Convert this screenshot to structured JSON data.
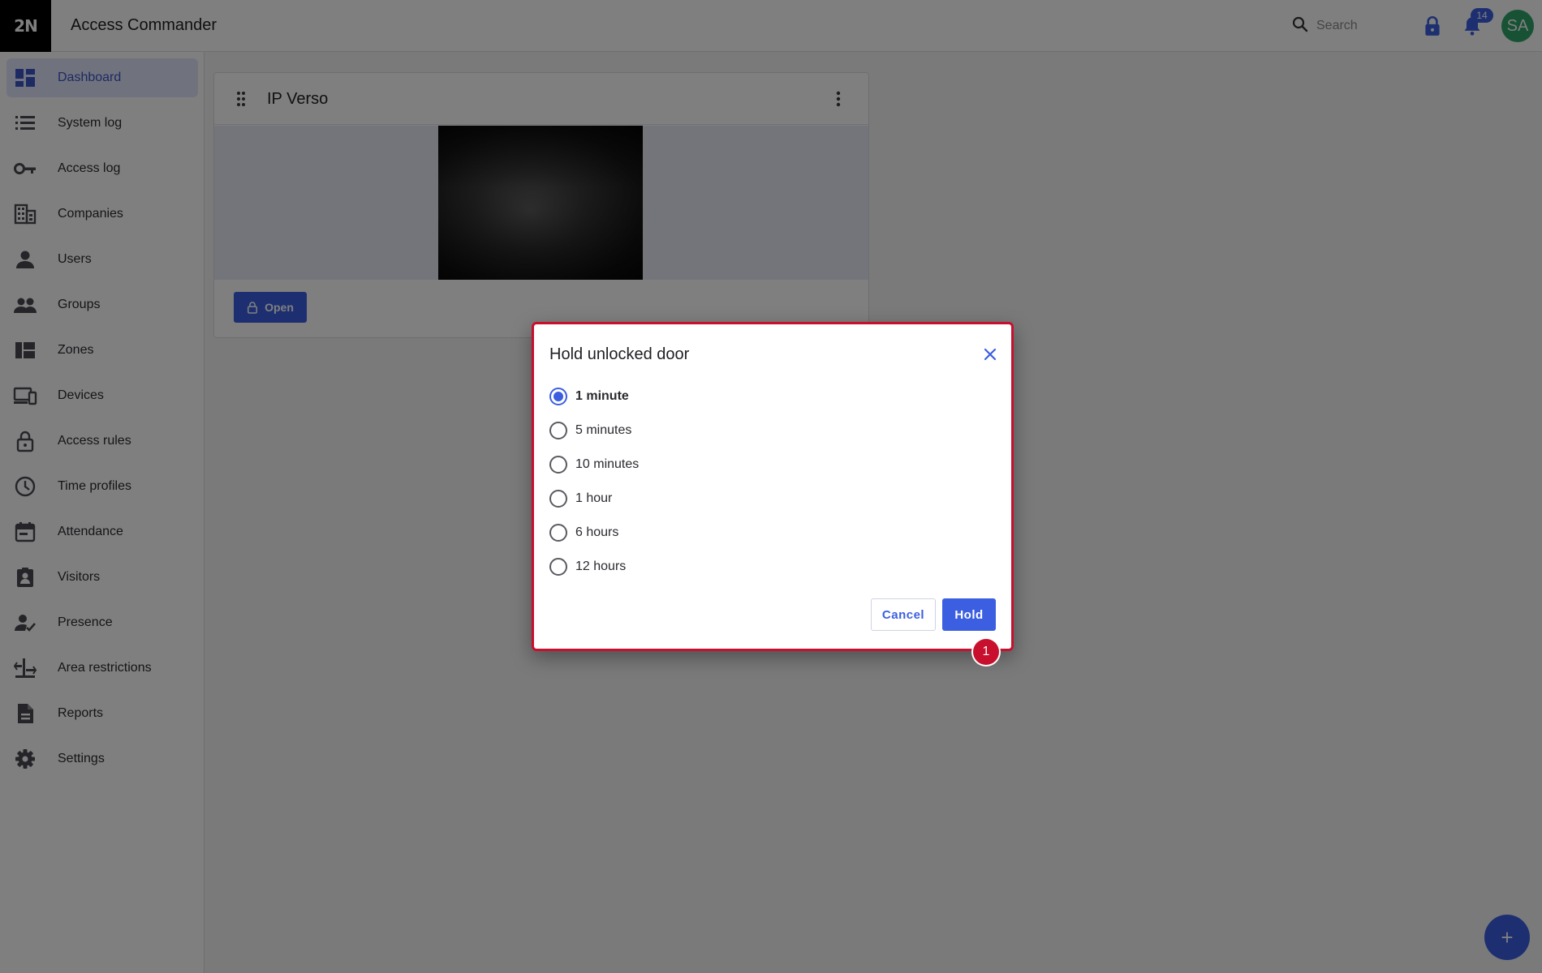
{
  "app": {
    "logo": "2N",
    "title": "Access Commander"
  },
  "topbar": {
    "search_placeholder": "Search",
    "notification_count": "14",
    "avatar_initials": "SA"
  },
  "sidebar": {
    "items": [
      {
        "label": "Dashboard",
        "icon": "dashboard-icon",
        "active": true
      },
      {
        "label": "System log",
        "icon": "list-icon"
      },
      {
        "label": "Access log",
        "icon": "key-icon"
      },
      {
        "label": "Companies",
        "icon": "building-icon"
      },
      {
        "label": "Users",
        "icon": "person-icon"
      },
      {
        "label": "Groups",
        "icon": "group-icon"
      },
      {
        "label": "Zones",
        "icon": "zones-icon"
      },
      {
        "label": "Devices",
        "icon": "devices-icon"
      },
      {
        "label": "Access rules",
        "icon": "lock-icon"
      },
      {
        "label": "Time profiles",
        "icon": "clock-icon"
      },
      {
        "label": "Attendance",
        "icon": "calendar-icon"
      },
      {
        "label": "Visitors",
        "icon": "visitor-badge-icon"
      },
      {
        "label": "Presence",
        "icon": "person-check-icon"
      },
      {
        "label": "Area restrictions",
        "icon": "area-restriction-icon"
      },
      {
        "label": "Reports",
        "icon": "document-icon"
      },
      {
        "label": "Settings",
        "icon": "gear-icon"
      }
    ]
  },
  "widget": {
    "title": "IP Verso",
    "open_label": "Open"
  },
  "dialog": {
    "title": "Hold unlocked door",
    "options": [
      {
        "label": "1 minute",
        "selected": true
      },
      {
        "label": "5 minutes",
        "selected": false
      },
      {
        "label": "10 minutes",
        "selected": false
      },
      {
        "label": "1 hour",
        "selected": false
      },
      {
        "label": "6 hours",
        "selected": false
      },
      {
        "label": "12 hours",
        "selected": false
      }
    ],
    "cancel_label": "Cancel",
    "hold_label": "Hold",
    "step_marker": "1"
  },
  "colors": {
    "accent": "#3b5fe0",
    "highlight": "#c8102e",
    "avatar": "#2ea56b"
  }
}
